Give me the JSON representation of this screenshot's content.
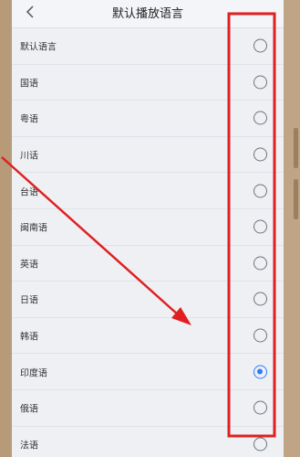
{
  "header": {
    "title": "默认播放语言"
  },
  "languages": [
    {
      "label": "默认语言",
      "selected": false
    },
    {
      "label": "国语",
      "selected": false
    },
    {
      "label": "粤语",
      "selected": false
    },
    {
      "label": "川话",
      "selected": false
    },
    {
      "label": "台语",
      "selected": false
    },
    {
      "label": "闽南语",
      "selected": false
    },
    {
      "label": "英语",
      "selected": false
    },
    {
      "label": "日语",
      "selected": false
    },
    {
      "label": "韩语",
      "selected": false
    },
    {
      "label": "印度语",
      "selected": true
    },
    {
      "label": "俄语",
      "selected": false
    },
    {
      "label": "法语",
      "selected": false
    }
  ],
  "colors": {
    "accent": "#2f7df6",
    "annotation": "#e02020"
  },
  "icons": {
    "back": "chevron-left-icon"
  }
}
